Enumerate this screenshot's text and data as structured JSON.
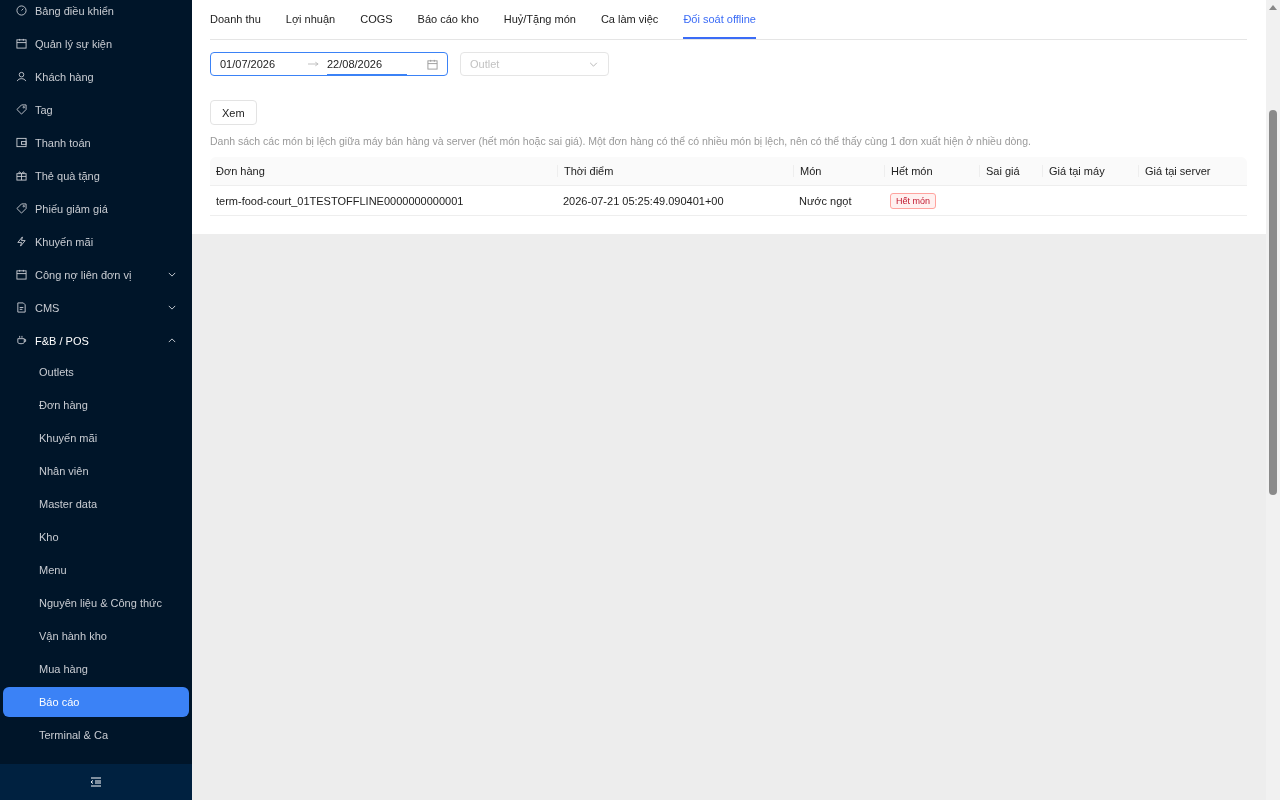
{
  "sidebar": {
    "items": [
      {
        "label": "Bảng điều khiển"
      },
      {
        "label": "Quản lý sự kiện"
      },
      {
        "label": "Khách hàng"
      },
      {
        "label": "Tag"
      },
      {
        "label": "Thanh toán"
      },
      {
        "label": "Thẻ quà tặng"
      },
      {
        "label": "Phiếu giảm giá"
      },
      {
        "label": "Khuyến mãi"
      },
      {
        "label": "Công nợ liên đơn vị",
        "expanded": false
      },
      {
        "label": "CMS",
        "expanded": false
      },
      {
        "label": "F&B / POS",
        "expanded": true,
        "children": [
          {
            "label": "Outlets",
            "selected": false
          },
          {
            "label": "Đơn hàng",
            "selected": false
          },
          {
            "label": "Khuyến mãi",
            "selected": false
          },
          {
            "label": "Nhân viên",
            "selected": false
          },
          {
            "label": "Master data",
            "selected": false
          },
          {
            "label": "Kho",
            "selected": false
          },
          {
            "label": "Menu",
            "selected": false
          },
          {
            "label": "Nguyên liệu & Công thức",
            "selected": false
          },
          {
            "label": "Vận hành kho",
            "selected": false
          },
          {
            "label": "Mua hàng",
            "selected": false
          },
          {
            "label": "Báo cáo",
            "selected": true
          },
          {
            "label": "Terminal & Ca",
            "selected": false
          }
        ]
      }
    ]
  },
  "tabs": [
    {
      "label": "Doanh thu",
      "selected": false
    },
    {
      "label": "Lợi nhuận",
      "selected": false
    },
    {
      "label": "COGS",
      "selected": false
    },
    {
      "label": "Báo cáo kho",
      "selected": false
    },
    {
      "label": "Huỷ/Tặng món",
      "selected": false
    },
    {
      "label": "Ca làm việc",
      "selected": false
    },
    {
      "label": "Đối soát offline",
      "selected": true
    }
  ],
  "date_range": {
    "start": "01/07/2026",
    "end": "22/08/2026"
  },
  "outlet_select": {
    "placeholder": "Outlet"
  },
  "view_button": "Xem",
  "description": "Danh sách các món bị lệch giữa máy bán hàng và server (hết món hoặc sai giá). Một đơn hàng có thể có nhiều món bị lệch, nên có thể thấy cùng 1 đơn xuất hiện ở nhiều dòng.",
  "table": {
    "columns": [
      "Đơn hàng",
      "Thời điểm",
      "Món",
      "Hết món",
      "Sai giá",
      "Giá tại máy",
      "Giá tại server"
    ],
    "rows": [
      {
        "cells": [
          {
            "kind": "text",
            "text": "term-food-court_01TESTOFFLINE0000000000001"
          },
          {
            "kind": "text",
            "text": "2026-07-21 05:25:49.090401+00"
          },
          {
            "kind": "text",
            "text": "Nước ngọt"
          },
          {
            "kind": "tag",
            "text": "Hết món"
          },
          {
            "kind": "empty"
          },
          {
            "kind": "empty"
          },
          {
            "kind": "empty"
          }
        ]
      }
    ]
  }
}
